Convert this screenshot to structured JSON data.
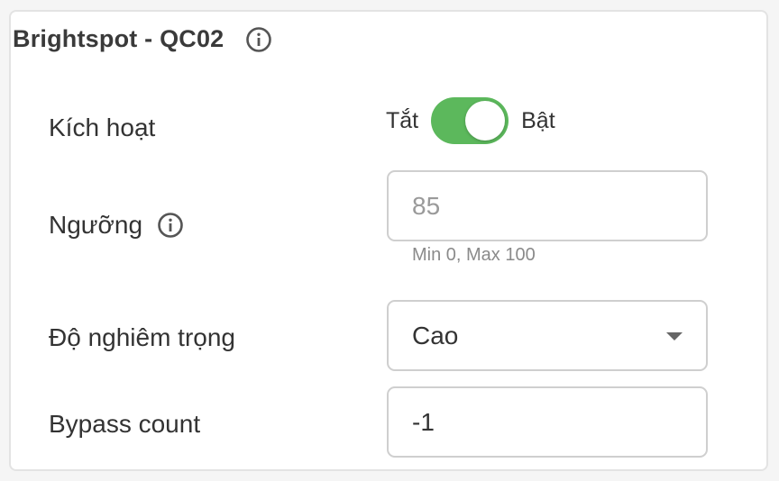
{
  "panel": {
    "title": "Brightspot - QC02",
    "title_info_icon": "info-circle-icon"
  },
  "activate": {
    "label": "Kích hoạt",
    "off_label": "Tắt",
    "on_label": "Bật",
    "state": "on",
    "accent_color": "#5cb85c"
  },
  "threshold": {
    "label": "Ngưỡng",
    "info_icon": "info-circle-icon",
    "placeholder": "85",
    "value": "",
    "hint": "Min 0, Max 100"
  },
  "severity": {
    "label": "Độ nghiêm trọng",
    "selected": "Cao"
  },
  "bypass": {
    "label": "Bypass count",
    "value": "-1"
  }
}
